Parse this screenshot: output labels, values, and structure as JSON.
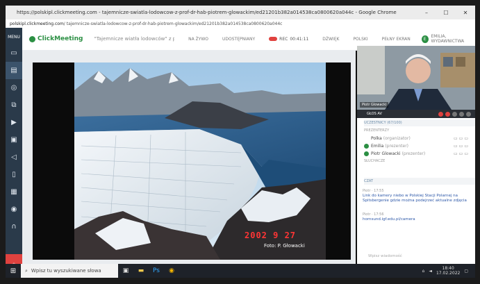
{
  "browser": {
    "title": "https://polskipl.clickmeeting.com - tajemnicze-swiatla-lodowcow-z-prof-dr-hab-piotrem-glowackim/ed21201b382a014538ca0800620a044c - Google Chrome",
    "minimize": "–",
    "maximize": "☐",
    "close": "✕",
    "address_domain": "polskipl.clickmeeting.com",
    "address_path": "/ tajemnicze-swiatla-lodowcow-z-prof-dr-hab-piotrem-glowackim/ed21201b382a014538ca0800620a044c"
  },
  "sidebar": {
    "menu_label": "MENU",
    "items": [
      "camera-icon",
      "presentation-icon",
      "compass-icon",
      "screen-share-icon",
      "video-icon",
      "files-icon",
      "megaphone-icon",
      "mobile-icon",
      "grid-icon",
      "broadcast-icon",
      "headset-icon"
    ]
  },
  "appbar": {
    "logo_text": "ClickMeeting",
    "room_name": "\"Tajemnicze wiatła lodowców\" z prof. dr hab. Piotrem...",
    "live_label": "NA ŻYWO",
    "share_label": "UDOSTĘPNIANY",
    "rec_label": "REC",
    "rec_time": "00:41:11",
    "sound_label": "DŹWIĘK",
    "lang_label": "POLSKI",
    "fullscreen_label": "PEŁNY EKRAN",
    "user_initial": "E",
    "user_name": "EMILIA, WYDAWNICTWA"
  },
  "presentation": {
    "date_stamp": "2002  9 27",
    "credit": "Foto: P. Głowacki"
  },
  "video": {
    "presenter_name": "Piotr Glowacki",
    "bar_label": "GŁOS AV"
  },
  "attendees": {
    "header": "UCZESTNICY (67/100)",
    "presenters_label": "PREZENTERZY",
    "presenters": [
      {
        "name": "Polka",
        "role": "(organizator)",
        "avatar": false
      },
      {
        "name": "Emilia",
        "role": "(prezenter)",
        "avatar": true
      },
      {
        "name": "Piotr Glowacki",
        "role": "(prezenter)",
        "avatar": true
      }
    ],
    "listeners_label": "SŁUCHACZE"
  },
  "chat": {
    "header": "CZAT",
    "messages": [
      {
        "who": "Piotr · 17:55",
        "text": "Link do kamery niebo w Polskiej Stacji Polarnej na Spitsbergenie gdzie można podejrzeć aktualne zdjęcia"
      },
      {
        "who": "Piotr · 17:56",
        "text": "hornsund.igf.edu.pl/camera"
      }
    ],
    "input_placeholder": "Wpisz wiadomość"
  },
  "taskbar": {
    "search_placeholder": "Wpisz tu wyszukiwane słowa",
    "time": "18:40",
    "date": "17.02.2022",
    "start_icon": "windows-icon"
  },
  "colors": {
    "brand": "#2b8f43",
    "alert": "#e0423f",
    "sidebar": "#2a3a4a",
    "date_stamp": "#ff3535"
  }
}
